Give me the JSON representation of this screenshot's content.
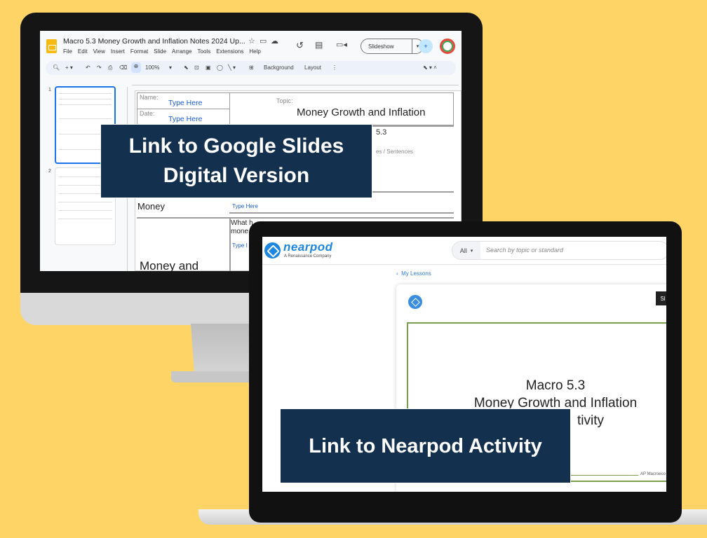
{
  "google_slides": {
    "doc_title": "Macro 5.3 Money Growth and Inflation Notes 2024 Up...",
    "menus": [
      "File",
      "Edit",
      "View",
      "Insert",
      "Format",
      "Slide",
      "Arrange",
      "Tools",
      "Extensions",
      "Help"
    ],
    "slideshow_label": "Slideshow",
    "zoom": "100%",
    "toolbar_background": "Background",
    "toolbar_layout": "Layout",
    "thumbnails": [
      "1",
      "2"
    ],
    "slide": {
      "name_label": "Name:",
      "date_label": "Date:",
      "name_value": "Type Here",
      "date_value": "Type Here",
      "topic_label": "Topic:",
      "topic_value": "Money Growth and Inflation",
      "unit_value": "5.3",
      "notes_hint": "es / Sentences",
      "row_money": "Money",
      "row_money_value": "Type Here",
      "row_what": "What h",
      "row_what2": "mone",
      "row_type": "Type I",
      "row_money_and": "Money and"
    }
  },
  "nearpod": {
    "brand": "nearpod",
    "subtitle": "A Renaissance Company",
    "search_filter": "All",
    "search_placeholder": "Search by topic or standard",
    "my_lessons": "My Lessons",
    "sl_badge": "Sl",
    "slide_title_line1": "Macro 5.3",
    "slide_title_line2": "Money Growth and Inflation",
    "slide_title_line3": "tivity",
    "slide_footer": "AP Macroeco"
  },
  "banners": {
    "slides_line1": "Link to Google Slides",
    "slides_line2": "Digital Version",
    "nearpod": "Link to Nearpod Activity"
  },
  "colors": {
    "background": "#ffd467",
    "banner": "#14304f",
    "nearpod_blue": "#1c86e0",
    "accent_green": "#7aa04e"
  }
}
